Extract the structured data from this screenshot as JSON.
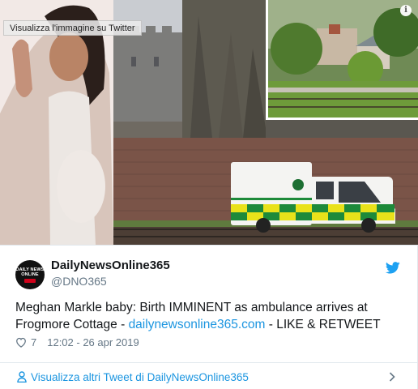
{
  "media": {
    "tooltip": "Visualizza l'immagine su Twitter",
    "info_glyph": "i"
  },
  "tweet": {
    "author_name": "DailyNewsOnline365",
    "author_handle": "@DNO365",
    "avatar_text": "DAILY NEWS ONLINE",
    "text_before_link": "Meghan Markle baby: Birth IMMINENT as ambulance arrives at Frogmore Cottage - ",
    "link_text": "dailynewsonline365.com",
    "text_after_link": " - LIKE & RETWEET",
    "like_count": "7",
    "timestamp": "12:02 - 26 apr 2019"
  },
  "footer": {
    "more_tweets_label": "Visualizza altri Tweet di DailyNewsOnline365"
  },
  "colors": {
    "link": "#1b95e0",
    "twitter_blue": "#1da1f2",
    "secondary_text": "#657786",
    "border": "#e1e8ed"
  }
}
